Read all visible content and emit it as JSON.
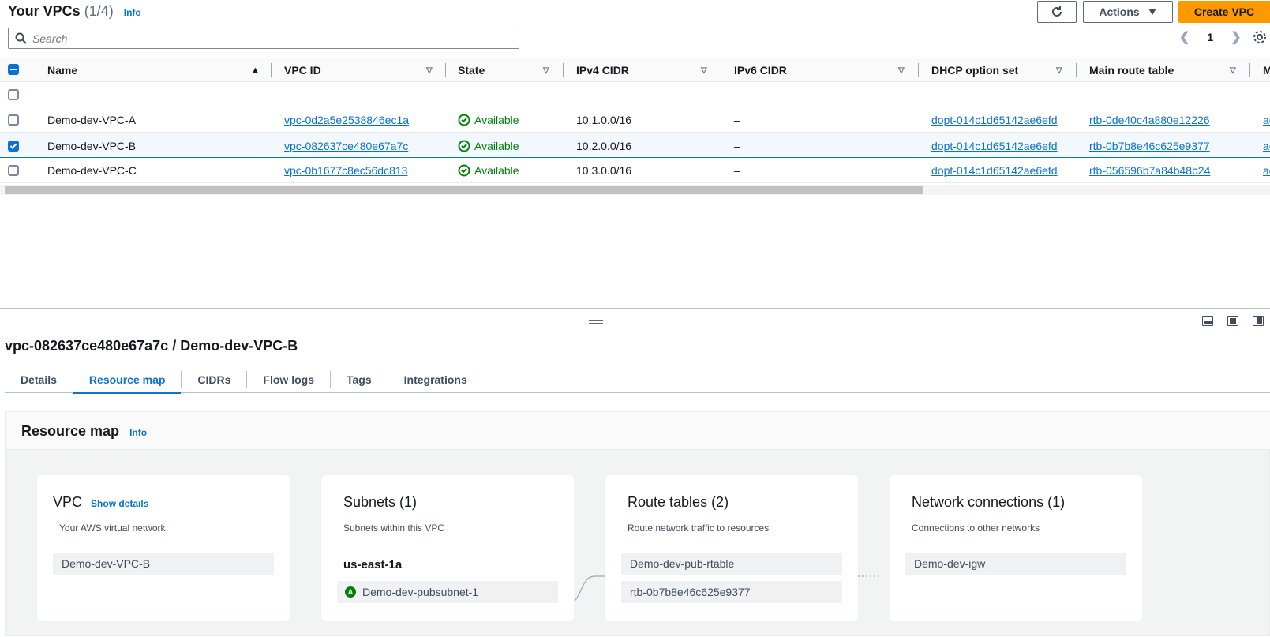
{
  "header": {
    "title": "Your VPCs",
    "count": "(1/4)",
    "info": "Info",
    "actions_label": "Actions",
    "create_label": "Create VPC"
  },
  "search": {
    "placeholder": "Search"
  },
  "pager": {
    "page": "1"
  },
  "columns": {
    "name": "Name",
    "vpc_id": "VPC ID",
    "state": "State",
    "ipv4": "IPv4 CIDR",
    "ipv6": "IPv6 CIDR",
    "dhcp": "DHCP option set",
    "route": "Main route table",
    "more": "M"
  },
  "rows": [
    {
      "name": "–",
      "vpc_id": "",
      "state": "",
      "ipv4": "",
      "ipv6": "",
      "dhcp": "",
      "route": "",
      "more": ""
    },
    {
      "name": "Demo-dev-VPC-A",
      "vpc_id": "vpc-0d2a5e2538846ec1a",
      "state": "Available",
      "ipv4": "10.1.0.0/16",
      "ipv6": "–",
      "dhcp": "dopt-014c1d65142ae6efd",
      "route": "rtb-0de40c4a880e12226",
      "more": "ac"
    },
    {
      "name": "Demo-dev-VPC-B",
      "vpc_id": "vpc-082637ce480e67a7c",
      "state": "Available",
      "ipv4": "10.2.0.0/16",
      "ipv6": "–",
      "dhcp": "dopt-014c1d65142ae6efd",
      "route": "rtb-0b7b8e46c625e9377",
      "more": "ac"
    },
    {
      "name": "Demo-dev-VPC-C",
      "vpc_id": "vpc-0b1677c8ec56dc813",
      "state": "Available",
      "ipv4": "10.3.0.0/16",
      "ipv6": "–",
      "dhcp": "dopt-014c1d65142ae6efd",
      "route": "rtb-056596b7a84b48b24",
      "more": "ac"
    }
  ],
  "detail": {
    "title": "vpc-082637ce480e67a7c / Demo-dev-VPC-B",
    "tabs": [
      "Details",
      "Resource map",
      "CIDRs",
      "Flow logs",
      "Tags",
      "Integrations"
    ]
  },
  "resource_map": {
    "title": "Resource map",
    "info": "Info",
    "vpc": {
      "title": "VPC",
      "link": "Show details",
      "sub": "Your AWS virtual network",
      "item": "Demo-dev-VPC-B"
    },
    "subnets": {
      "title": "Subnets (1)",
      "sub": "Subnets within this VPC",
      "az": "us-east-1a",
      "badge": "A",
      "item": "Demo-dev-pubsubnet-1"
    },
    "routes": {
      "title": "Route tables (2)",
      "sub": "Route network traffic to resources",
      "items": [
        "Demo-dev-pub-rtable",
        "rtb-0b7b8e46c625e9377"
      ]
    },
    "network": {
      "title": "Network connections (1)",
      "sub": "Connections to other networks",
      "item": "Demo-dev-igw"
    }
  },
  "colors": {
    "link": "#0972d3",
    "primary": "#ff9900",
    "success": "#037f0c"
  }
}
